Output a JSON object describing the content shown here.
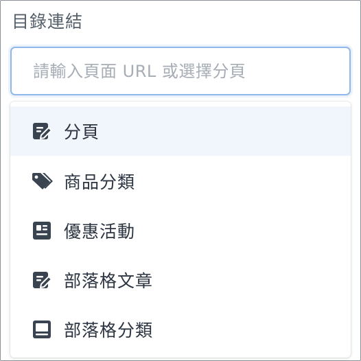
{
  "field": {
    "label": "目錄連結",
    "placeholder": "請輸入頁面 URL 或選擇分頁",
    "value": ""
  },
  "dropdown": {
    "options": [
      {
        "label": "分頁",
        "icon": "edit-page-icon",
        "highlighted": true
      },
      {
        "label": "商品分類",
        "icon": "tags-icon",
        "highlighted": false
      },
      {
        "label": "優惠活動",
        "icon": "promotion-card-icon",
        "highlighted": false
      },
      {
        "label": "部落格文章",
        "icon": "edit-page-icon",
        "highlighted": false
      },
      {
        "label": "部落格分類",
        "icon": "blog-category-icon",
        "highlighted": false
      }
    ]
  },
  "colors": {
    "highlight_row": "#f1f5fc",
    "input_focus_border": "#8fb7e9",
    "icon": "#3a4350",
    "text": "#2b3440"
  }
}
